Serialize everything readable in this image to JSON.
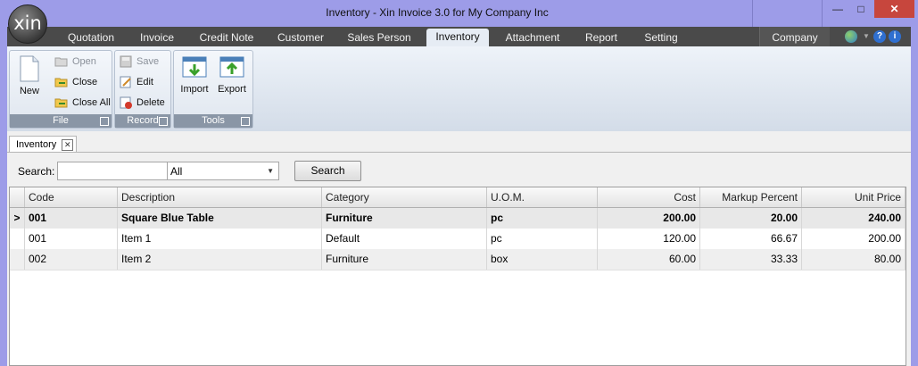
{
  "window": {
    "title": "Inventory - Xin Invoice 3.0 for My Company Inc",
    "logo_text": "xin",
    "minimize_icon": "minimize-icon",
    "maximize_icon": "maximize-icon",
    "close_icon": "close-icon"
  },
  "menu_tabs": [
    {
      "label": "Quotation"
    },
    {
      "label": "Invoice"
    },
    {
      "label": "Credit Note"
    },
    {
      "label": "Customer"
    },
    {
      "label": "Sales Person"
    },
    {
      "label": "Inventory",
      "active": true
    },
    {
      "label": "Attachment"
    },
    {
      "label": "Report"
    },
    {
      "label": "Setting"
    }
  ],
  "company_tab": "Company",
  "ribbon": {
    "file": {
      "label": "File",
      "new": "New",
      "open": "Open",
      "close": "Close",
      "close_all": "Close All"
    },
    "record": {
      "label": "Record",
      "save": "Save",
      "edit": "Edit",
      "delete": "Delete"
    },
    "tools": {
      "label": "Tools",
      "import": "Import",
      "export": "Export"
    }
  },
  "document_tab": {
    "label": "Inventory"
  },
  "search": {
    "label": "Search:",
    "value": "",
    "filter_value": "All",
    "button": "Search"
  },
  "grid": {
    "columns": [
      "Code",
      "Description",
      "Category",
      "U.O.M.",
      "Cost",
      "Markup Percent",
      "Unit Price"
    ],
    "current_row_marker": ">",
    "rows": [
      {
        "code": "001",
        "description": "Square Blue Table",
        "category": "Furniture",
        "uom": "pc",
        "cost": "200.00",
        "markup": "20.00",
        "price": "240.00"
      },
      {
        "code": "001",
        "description": "Item 1",
        "category": "Default",
        "uom": "pc",
        "cost": "120.00",
        "markup": "66.67",
        "price": "200.00"
      },
      {
        "code": "002",
        "description": "Item 2",
        "category": "Furniture",
        "uom": "box",
        "cost": "60.00",
        "markup": "33.33",
        "price": "80.00"
      }
    ]
  },
  "colors": {
    "title_bar": "#9d9ce8",
    "tab_bar": "#4a4a4a",
    "close_button": "#c7463d"
  }
}
